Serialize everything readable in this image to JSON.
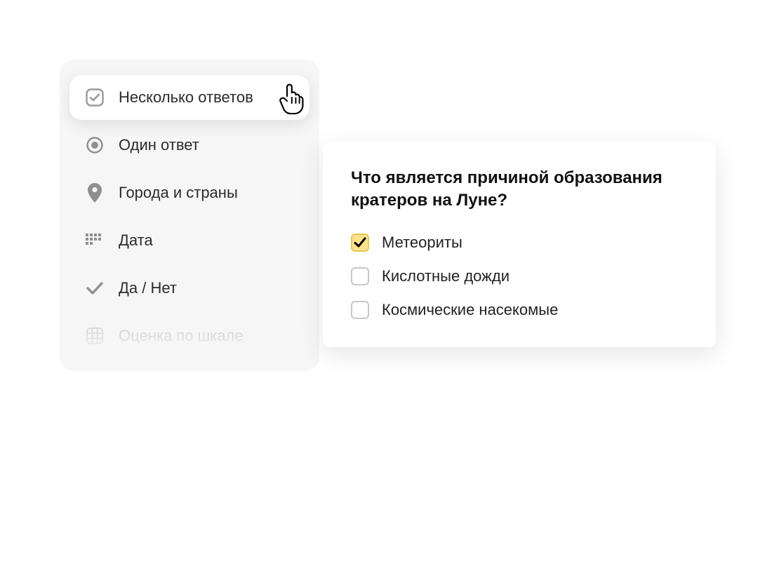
{
  "type_panel": {
    "items": [
      {
        "key": "multiple",
        "label": "Несколько ответов",
        "icon": "checkbox-icon",
        "active": true
      },
      {
        "key": "single",
        "label": "Один ответ",
        "icon": "radio-icon",
        "active": false
      },
      {
        "key": "geo",
        "label": "Города и страны",
        "icon": "location-pin-icon",
        "active": false
      },
      {
        "key": "date",
        "label": "Дата",
        "icon": "date-grid-icon",
        "active": false
      },
      {
        "key": "yesno",
        "label": "Да / Нет",
        "icon": "checkmark-icon",
        "active": false
      },
      {
        "key": "scale",
        "label": "Оценка по шкале",
        "icon": "grid-icon",
        "active": false,
        "faded": true
      }
    ]
  },
  "preview": {
    "question": "Что является причиной образования кратеров на Луне?",
    "answers": [
      {
        "label": "Метеориты",
        "checked": true
      },
      {
        "label": "Кислотные дожди",
        "checked": false
      },
      {
        "label": "Космические насекомые",
        "checked": false
      }
    ]
  },
  "colors": {
    "panel_bg": "#f6f6f6",
    "checkbox_checked_bg": "#ffe38a",
    "checkbox_checked_border": "#e7c659"
  }
}
